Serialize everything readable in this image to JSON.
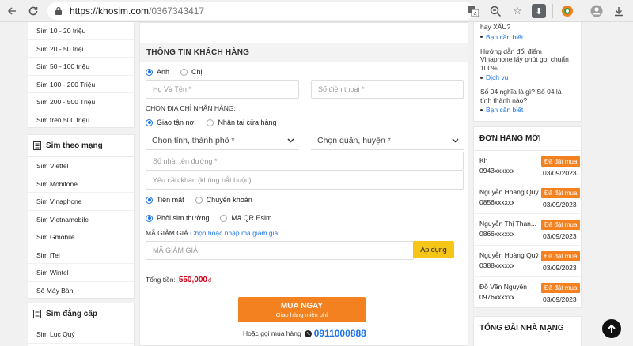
{
  "browser": {
    "url_domain": "https://khosim.com",
    "url_path": "/0367343417"
  },
  "left_sidebar": {
    "price_items": [
      "Sim 10 - 20 triệu",
      "Sim 20 - 50 triệu",
      "Sim 50 - 100 triệu",
      "Sim 100 - 200 Triệu",
      "Sim 200 - 500 Triệu",
      "Sim trên 500 triệu"
    ],
    "network_title": "Sim theo mạng",
    "network_items": [
      "Sim Viettel",
      "Sim Mobifone",
      "Sim Vinaphone",
      "Sim Vietnamobile",
      "Sim Gmobile",
      "Sim iTel",
      "Sim Wintel",
      "Số Máy Bàn"
    ],
    "class_title": "Sim đẳng cấp",
    "class_items": [
      "Sim Lục Quý"
    ]
  },
  "form": {
    "section_title": "THÔNG TIN KHÁCH HÀNG",
    "gender": {
      "male": "Anh",
      "female": "Chị"
    },
    "name_placeholder": "Họ Và Tên *",
    "phone_placeholder": "Số điện thoại *",
    "address_label": "CHỌN ĐỊA CHỈ NHẬN HÀNG:",
    "delivery": {
      "home": "Giao tận nơi",
      "store": "Nhận tại cửa hàng"
    },
    "province_select": "Chọn tỉnh, thành phố *",
    "district_select": "Chọn quận, huyện *",
    "house_placeholder": "Số nhà, tên đường *",
    "note_placeholder": "Yêu cầu khác (không bắt buộc)",
    "payment": {
      "cash": "Tiền mặt",
      "transfer": "Chuyển khoản"
    },
    "sim_type": {
      "physical": "Phôi sim thường",
      "esim": "Mã QR Esim"
    },
    "coupon_label": "MÃ GIẢM GIÁ",
    "coupon_link": "Chọn hoặc nhập mã giảm giá",
    "coupon_placeholder": "MÃ GIẢM GIÁ",
    "apply_label": "Áp dụng",
    "total_label": "Tổng tiền:",
    "total_value": "550,000",
    "currency": "đ",
    "buy_label": "MUA NGAY",
    "buy_sub": "Giao hàng miễn phí",
    "or_call": "Hoặc gọi mua hàng",
    "hotline": "0911000888"
  },
  "right_sidebar": {
    "news": [
      {
        "title": "hay XẤU?",
        "more": "Bạn cần biết"
      },
      {
        "title": "Hướng dẫn đổi điểm Vinaphone lấy phút gọi chuẩn 100%",
        "more": "Dịch vụ"
      },
      {
        "title": "Số 04 nghĩa là gì? Số 04 là tính thành nào?",
        "more": "Bạn cần biết"
      }
    ],
    "orders_title": "ĐƠN HÀNG MỚI",
    "orders": [
      {
        "name": "Kh",
        "phone": "0943xxxxxx",
        "status": "Đã đặt mua",
        "date": "03/09/2023"
      },
      {
        "name": "Nguyễn Hoàng Quý",
        "phone": "0856xxxxxx",
        "status": "Đã đặt mua",
        "date": "03/09/2023"
      },
      {
        "name": "Nguyễn Thị Than...",
        "phone": "0866xxxxxx",
        "status": "Đã đặt mua",
        "date": "03/09/2023"
      },
      {
        "name": "Nguyễn Hoàng Quý",
        "phone": "0388xxxxxx",
        "status": "Đã đặt mua",
        "date": "03/09/2023"
      },
      {
        "name": "Đỗ Văn Nguyên",
        "phone": "0976xxxxxx",
        "status": "Đã đặt mua",
        "date": "03/09/2023"
      }
    ],
    "switchboard_title": "TỔNG ĐÀI NHÀ MẠNG"
  },
  "colors": {
    "accent": "#1a73e8",
    "orange": "#f48120",
    "yellow": "#f5c518",
    "price": "#d0021b"
  }
}
